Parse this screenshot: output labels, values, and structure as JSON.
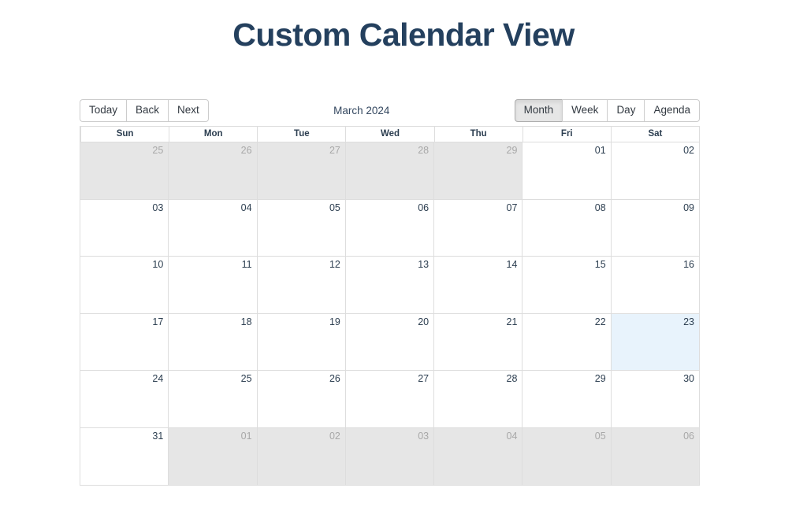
{
  "page": {
    "title": "Custom Calendar View",
    "title_color": "#24405e",
    "background": "#ffffff"
  },
  "calendar": {
    "toolbar": {
      "nav_buttons": [
        {
          "label": "Today",
          "name": "today-button",
          "active": false
        },
        {
          "label": "Back",
          "name": "back-button",
          "active": false
        },
        {
          "label": "Next",
          "name": "next-button",
          "active": false
        }
      ],
      "current_range_label": "March 2024",
      "view_buttons": [
        {
          "label": "Month",
          "name": "view-month-button",
          "active": true
        },
        {
          "label": "Week",
          "name": "view-week-button",
          "active": false
        },
        {
          "label": "Day",
          "name": "view-day-button",
          "active": false
        },
        {
          "label": "Agenda",
          "name": "view-agenda-button",
          "active": false
        }
      ]
    },
    "weekday_headers": [
      "Sun",
      "Mon",
      "Tue",
      "Wed",
      "Thu",
      "Fri",
      "Sat"
    ],
    "active_view": "Month",
    "month": "March",
    "year": "2024",
    "today_date": "23",
    "colors": {
      "off_range_background": "#e6e6e6",
      "off_range_text": "#a8a8a8",
      "in_range_background": "#ffffff",
      "in_range_text": "#2c3e50",
      "today_background": "#e8f3fc",
      "grid_border": "#dddddd",
      "button_border": "#cccccc",
      "button_active_background": "#e6e6e6"
    },
    "weeks": [
      [
        {
          "day": "25",
          "off_range": true,
          "today": false
        },
        {
          "day": "26",
          "off_range": true,
          "today": false
        },
        {
          "day": "27",
          "off_range": true,
          "today": false
        },
        {
          "day": "28",
          "off_range": true,
          "today": false
        },
        {
          "day": "29",
          "off_range": true,
          "today": false
        },
        {
          "day": "01",
          "off_range": false,
          "today": false
        },
        {
          "day": "02",
          "off_range": false,
          "today": false
        }
      ],
      [
        {
          "day": "03",
          "off_range": false,
          "today": false
        },
        {
          "day": "04",
          "off_range": false,
          "today": false
        },
        {
          "day": "05",
          "off_range": false,
          "today": false
        },
        {
          "day": "06",
          "off_range": false,
          "today": false
        },
        {
          "day": "07",
          "off_range": false,
          "today": false
        },
        {
          "day": "08",
          "off_range": false,
          "today": false
        },
        {
          "day": "09",
          "off_range": false,
          "today": false
        }
      ],
      [
        {
          "day": "10",
          "off_range": false,
          "today": false
        },
        {
          "day": "11",
          "off_range": false,
          "today": false
        },
        {
          "day": "12",
          "off_range": false,
          "today": false
        },
        {
          "day": "13",
          "off_range": false,
          "today": false
        },
        {
          "day": "14",
          "off_range": false,
          "today": false
        },
        {
          "day": "15",
          "off_range": false,
          "today": false
        },
        {
          "day": "16",
          "off_range": false,
          "today": false
        }
      ],
      [
        {
          "day": "17",
          "off_range": false,
          "today": false
        },
        {
          "day": "18",
          "off_range": false,
          "today": false
        },
        {
          "day": "19",
          "off_range": false,
          "today": false
        },
        {
          "day": "20",
          "off_range": false,
          "today": false
        },
        {
          "day": "21",
          "off_range": false,
          "today": false
        },
        {
          "day": "22",
          "off_range": false,
          "today": false
        },
        {
          "day": "23",
          "off_range": false,
          "today": true
        }
      ],
      [
        {
          "day": "24",
          "off_range": false,
          "today": false
        },
        {
          "day": "25",
          "off_range": false,
          "today": false
        },
        {
          "day": "26",
          "off_range": false,
          "today": false
        },
        {
          "day": "27",
          "off_range": false,
          "today": false
        },
        {
          "day": "28",
          "off_range": false,
          "today": false
        },
        {
          "day": "29",
          "off_range": false,
          "today": false
        },
        {
          "day": "30",
          "off_range": false,
          "today": false
        }
      ],
      [
        {
          "day": "31",
          "off_range": false,
          "today": false
        },
        {
          "day": "01",
          "off_range": true,
          "today": false
        },
        {
          "day": "02",
          "off_range": true,
          "today": false
        },
        {
          "day": "03",
          "off_range": true,
          "today": false
        },
        {
          "day": "04",
          "off_range": true,
          "today": false
        },
        {
          "day": "05",
          "off_range": true,
          "today": false
        },
        {
          "day": "06",
          "off_range": true,
          "today": false
        }
      ]
    ]
  }
}
